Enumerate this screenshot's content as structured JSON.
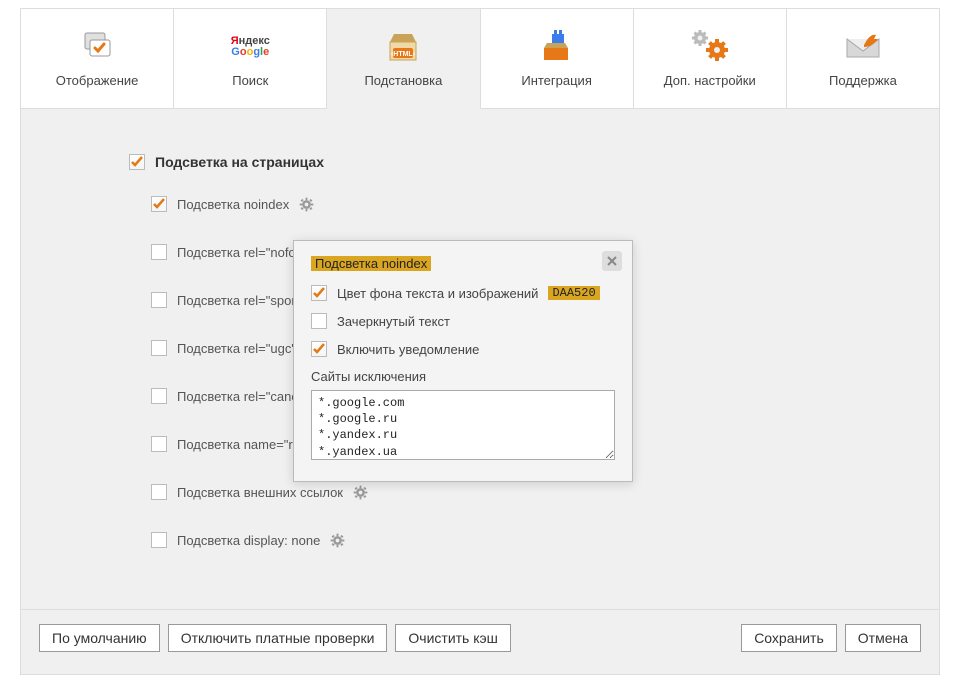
{
  "tabs": [
    {
      "label": "Отображение"
    },
    {
      "label": "Поиск"
    },
    {
      "label": "Подстановка"
    },
    {
      "label": "Интеграция"
    },
    {
      "label": "Доп. настройки"
    },
    {
      "label": "Поддержка"
    }
  ],
  "section_title": "Подсветка на страницах",
  "options": [
    {
      "label": "Подсветка noindex",
      "checked": true,
      "gear": true
    },
    {
      "label": "Подсветка rel=\"nofollow\"",
      "checked": false,
      "gear": false
    },
    {
      "label": "Подсветка rel=\"sponsored\"",
      "checked": false,
      "gear": false
    },
    {
      "label": "Подсветка rel=\"ugc\"",
      "checked": false,
      "gear": false
    },
    {
      "label": "Подсветка rel=\"canonical\"",
      "checked": false,
      "gear": false
    },
    {
      "label": "Подсветка name=\"robots\"",
      "checked": false,
      "gear": false
    },
    {
      "label": "Подсветка внешних ссылок",
      "checked": false,
      "gear": true
    },
    {
      "label": "Подсветка display: none",
      "checked": false,
      "gear": true
    }
  ],
  "popup": {
    "title": "Подсветка noindex",
    "bg_color_label": "Цвет фона текста и изображений",
    "bg_color_value": "DAA520",
    "strike_label": "Зачеркнутый текст",
    "notify_label": "Включить уведомление",
    "exclusion_label": "Сайты исключения",
    "exclusion_text": "*.google.com\n*.google.ru\n*.yandex.ru\n*.yandex.ua"
  },
  "footer": {
    "defaults": "По умолчанию",
    "disable_paid": "Отключить платные проверки",
    "clear_cache": "Очистить кэш",
    "save": "Сохранить",
    "cancel": "Отмена"
  }
}
